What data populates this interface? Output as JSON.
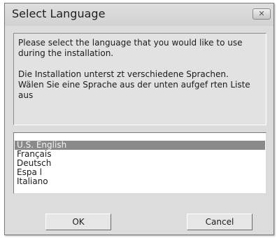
{
  "window": {
    "title": "Select Language",
    "close_label": "✕"
  },
  "message": {
    "line1": "Please select the language that you would like to use during the installation.",
    "line2": "Die Installation unterst­ zt verschiedene Sprachen.",
    "line3": "Wälen Sie eine Sprache aus der unten aufgef­ rten Liste aus"
  },
  "language_list": {
    "items": [
      "U.S. English",
      "Français",
      "Deutsch",
      "Espa l",
      "Italiano"
    ],
    "selected_index": 0
  },
  "buttons": {
    "ok_label": "OK",
    "cancel_label": "Cancel"
  },
  "colors": {
    "selection": "#8a8a8a",
    "dialog_bg": "#dcdcdc"
  }
}
